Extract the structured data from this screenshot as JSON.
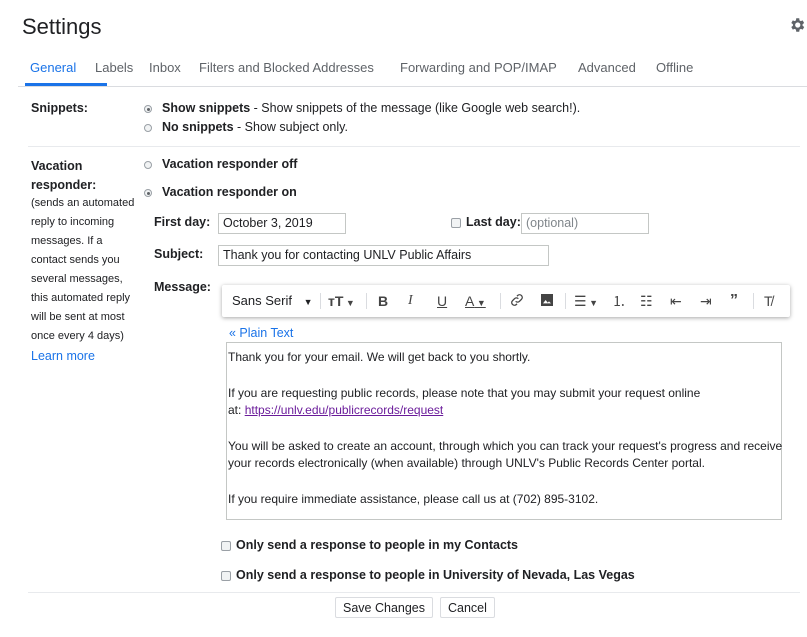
{
  "header": {
    "title": "Settings",
    "settings_icon": "gear-icon"
  },
  "tabs": [
    {
      "label": "General",
      "active": true
    },
    {
      "label": "Labels"
    },
    {
      "label": "Inbox"
    },
    {
      "label": "Filters and Blocked Addresses"
    },
    {
      "label": "Forwarding and POP/IMAP"
    },
    {
      "label": "Advanced"
    },
    {
      "label": "Offline"
    }
  ],
  "snippets": {
    "label": "Snippets:",
    "options": [
      {
        "title": "Show snippets",
        "desc": " - Show snippets of the message (like Google web search!).",
        "checked": true
      },
      {
        "title": "No snippets",
        "desc": " - Show subject only.",
        "checked": false
      }
    ]
  },
  "vacation": {
    "label": "Vacation responder:",
    "description_lines": [
      "(sends an automated",
      "reply to incoming",
      "messages. If a",
      "contact sends you",
      "several messages,",
      "this automated reply",
      "will be sent at most",
      "once every 4 days)"
    ],
    "learn_more": "Learn more",
    "off_label": "Vacation responder off",
    "on_label": "Vacation responder on",
    "first_day_label": "First day:",
    "first_day_value": "October 3, 2019",
    "last_day_label": "Last day:",
    "last_day_placeholder": "(optional)",
    "subject_label": "Subject:",
    "subject_value": "Thank you for contacting UNLV Public Affairs",
    "message_label": "Message:",
    "toolbar": {
      "font": "Sans Serif",
      "size_icon": "text-size-icon",
      "bold": "B",
      "italic": "I",
      "underline": "U",
      "text_color": "A",
      "icons": [
        "link-icon",
        "image-icon",
        "align-icon",
        "numbered-list-icon",
        "bulleted-list-icon",
        "indent-less-icon",
        "indent-more-icon",
        "quote-icon",
        "remove-formatting-icon"
      ]
    },
    "plain_text_link": "« Plain Text",
    "message_lines": {
      "l1": "Thank you for your email. We will get back to you shortly.",
      "l2": "If you are requesting public records, please note that you may submit your request online",
      "l3_prefix": "at: ",
      "l3_link": "https://unlv.edu/publicrecords/request",
      "l4": "You will be asked to create an account, through which you can track your request's progress and receive",
      "l5": "your records electronically (when available) through UNLV's Public Records Center portal.",
      "l6": "If you require immediate assistance, please call us at (702) 895-3102."
    },
    "contacts_only": "Only send a response to people in my Contacts",
    "org_only": "Only send a response to people in University of Nevada, Las Vegas"
  },
  "footer": {
    "save_label": "Save Changes",
    "cancel_label": "Cancel"
  }
}
